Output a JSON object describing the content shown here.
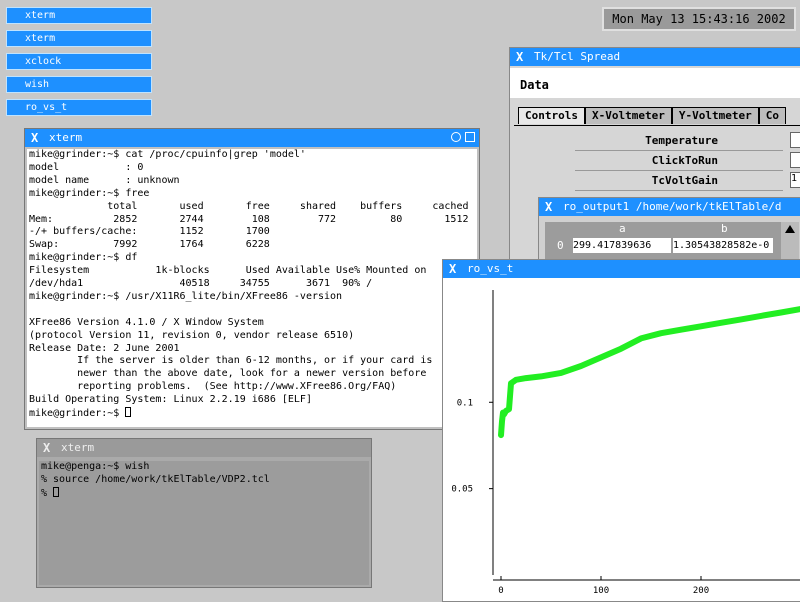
{
  "taskbar": {
    "items": [
      "xterm",
      "xterm",
      "xclock",
      "wish",
      "ro_vs_t"
    ]
  },
  "clock": "Mon May 13 15:43:16 2002",
  "spread": {
    "title": "Tk/Tcl Spread",
    "menu": "Data",
    "tabs": [
      "Controls",
      "X-Voltmeter",
      "Y-Voltmeter",
      "Co"
    ],
    "rows": [
      {
        "label": "Temperature",
        "value": ""
      },
      {
        "label": "ClickToRun",
        "value": ""
      },
      {
        "label": "TcVoltGain",
        "value": "1"
      }
    ]
  },
  "ro_output": {
    "title": "ro_output1 /home/work/tkElTable/d",
    "columns": [
      "a",
      "b"
    ],
    "row_index": "0",
    "cell_a": "299.417839636",
    "cell_b": "1.30543828582e-0"
  },
  "xterm_main": {
    "title": "xterm",
    "lines": [
      "mike@grinder:~$ cat /proc/cpuinfo|grep 'model'",
      "model           : 0",
      "model name      : unknown",
      "mike@grinder:~$ free",
      "             total       used       free     shared    buffers     cached",
      "Mem:          2852       2744        108        772         80       1512",
      "-/+ buffers/cache:       1152       1700",
      "Swap:         7992       1764       6228",
      "mike@grinder:~$ df",
      "Filesystem           1k-blocks      Used Available Use% Mounted on",
      "/dev/hda1                40518     34755      3671  90% /",
      "mike@grinder:~$ /usr/X11R6_lite/bin/XFree86 -version",
      "",
      "XFree86 Version 4.1.0 / X Window System",
      "(protocol Version 11, revision 0, vendor release 6510)",
      "Release Date: 2 June 2001",
      "        If the server is older than 6-12 months, or if your card is",
      "        newer than the above date, look for a newer version before",
      "        reporting problems.  (See http://www.XFree86.Org/FAQ)",
      "Build Operating System: Linux 2.2.19 i686 [ELF]"
    ],
    "prompt": "mike@grinder:~$ "
  },
  "xterm_small": {
    "title": "xterm",
    "lines": [
      "mike@penga:~$ wish",
      "% source /home/work/tkElTable/VDP2.tcl"
    ],
    "prompt": "% "
  },
  "plot": {
    "title": "ro_vs_t",
    "line_color": "#22ee22",
    "chart_data": {
      "type": "line",
      "xlim": [
        0,
        300
      ],
      "ylim": [
        0.0,
        0.165
      ],
      "x_ticks": [
        "0",
        "100",
        "200"
      ],
      "y_ticks": [
        "0.1",
        "0.05"
      ],
      "x_tick_values": [
        0,
        100,
        200
      ],
      "y_tick_values": [
        0.1,
        0.05
      ],
      "series": [
        {
          "x": [
            0,
            1,
            2,
            3,
            5,
            8,
            10,
            15,
            25,
            40,
            60,
            80,
            100,
            120,
            140,
            160,
            180,
            200,
            220,
            240,
            260,
            280,
            300
          ],
          "y": [
            0.081,
            0.089,
            0.094,
            0.093,
            0.095,
            0.096,
            0.111,
            0.113,
            0.114,
            0.115,
            0.117,
            0.121,
            0.126,
            0.131,
            0.137,
            0.14,
            0.142,
            0.144,
            0.146,
            0.148,
            0.15,
            0.152,
            0.154
          ]
        }
      ]
    }
  }
}
